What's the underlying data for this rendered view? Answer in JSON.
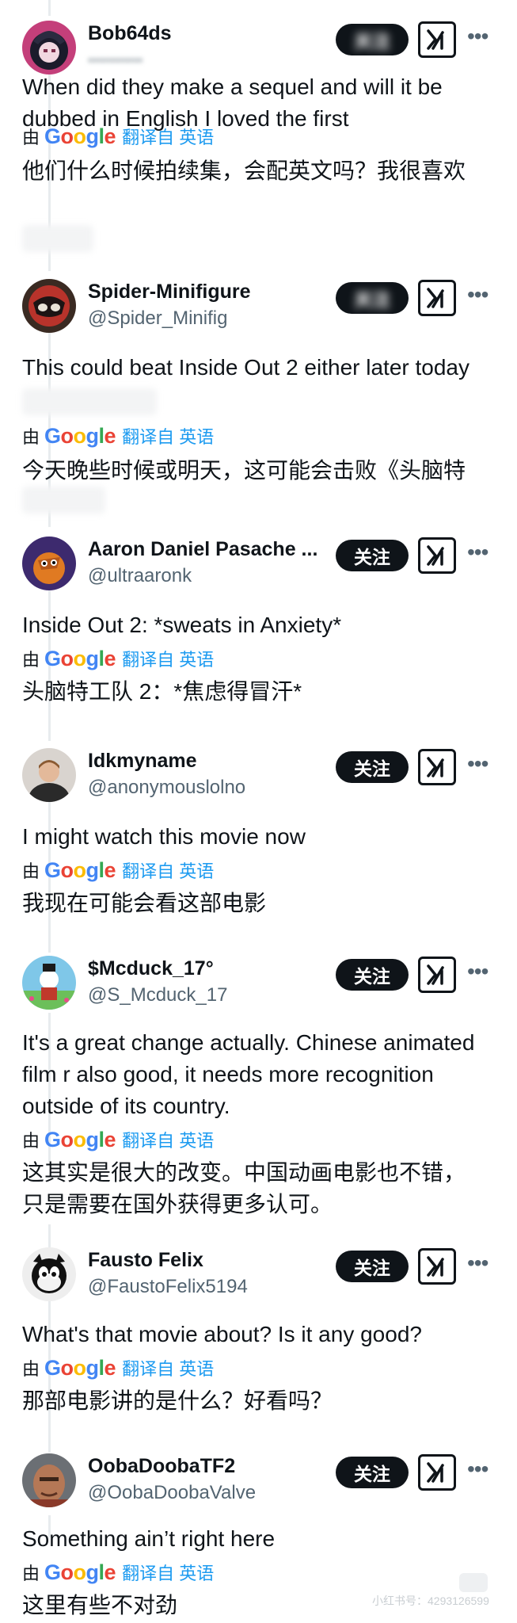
{
  "colors": {
    "text": "#0f1419",
    "muted": "#536471",
    "accent": "#1d9bf0",
    "button_bg": "#0f1419"
  },
  "translate": {
    "by": "由",
    "brand": [
      "G",
      "o",
      "o",
      "g",
      "l",
      "e"
    ],
    "from": "翻译自 英语"
  },
  "follow_label": "关注",
  "posts": [
    {
      "name": "Bob64ds",
      "handle": "",
      "text": "When did they make a sequel and will it be dubbed in English I loved the first",
      "zh": "他们什么时候拍续集，会配英文吗？我很喜欢",
      "button": ""
    },
    {
      "name": "Spider-Minifigure",
      "handle": "@Spider_Minifig",
      "text": "This could beat Inside Out 2 either later today",
      "zh": "今天晚些时候或明天，这可能会击败《头脑特",
      "button": ""
    },
    {
      "name": "Aaron Daniel Pasache ...",
      "handle": "@ultraaronk",
      "text": "Inside Out 2: *sweats in Anxiety*",
      "zh": "头脑特工队 2：*焦虑得冒汗*",
      "button": "关注"
    },
    {
      "name": "Idkmyname",
      "handle": "@anonymouslolno",
      "text": "I might watch this movie now",
      "zh": "我现在可能会看这部电影",
      "button": "关注"
    },
    {
      "name": "$Mcduck_17°",
      "handle": "@S_Mcduck_17",
      "text": "It's a great change actually. Chinese animated film r also good, it needs more recognition outside of its country.",
      "zh": "这其实是很大的改变。中国动画电影也不错，\n只是需要在国外获得更多认可。",
      "button": "关注"
    },
    {
      "name": "Fausto Felix",
      "handle": "@FaustoFelix5194",
      "text": "What's that movie about? Is it any good?",
      "zh": "那部电影讲的是什么？好看吗？",
      "button": "关注"
    },
    {
      "name": "OobaDoobaTF2",
      "handle": "@OobaDoobaValve",
      "text": "Something ain’t right here",
      "zh": "这里有些不对劲",
      "button": "关注"
    }
  ],
  "watermark": "小红书号：4293126599"
}
